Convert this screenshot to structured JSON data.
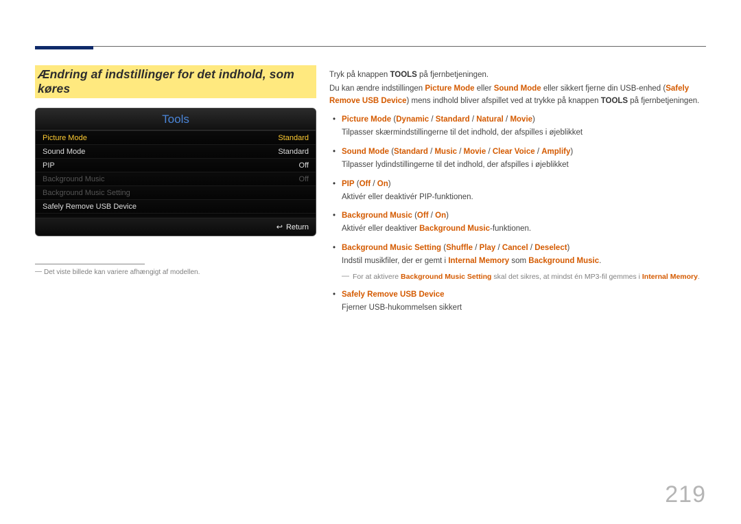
{
  "page_number": "219",
  "heading": "Ændring af indstillinger for det indhold, som køres",
  "tools_panel": {
    "title": "Tools",
    "rows": [
      {
        "label": "Picture Mode",
        "value": "Standard",
        "state": "selected"
      },
      {
        "label": "Sound Mode",
        "value": "Standard",
        "state": "normal"
      },
      {
        "label": "PIP",
        "value": "Off",
        "state": "normal"
      },
      {
        "label": "Background Music",
        "value": "Off",
        "state": "dim"
      },
      {
        "label": "Background Music Setting",
        "value": "",
        "state": "dim"
      },
      {
        "label": "Safely Remove USB Device",
        "value": "",
        "state": "normal"
      }
    ],
    "footer_label": "Return"
  },
  "footnote": "Det viste billede kan variere afhængigt af modellen.",
  "intro": {
    "line1_a": "Tryk på knappen ",
    "line1_b": "TOOLS",
    "line1_c": " på fjernbetjeningen.",
    "line2_a": "Du kan ændre indstillingen ",
    "line2_b": "Picture Mode",
    "line2_c": " eller ",
    "line2_d": "Sound Mode",
    "line2_e": " eller sikkert fjerne din USB-enhed (",
    "line2_f": "Safely Remove USB Device",
    "line2_g": ") mens indhold bliver afspillet ved at trykke på knappen ",
    "line2_h": "TOOLS",
    "line2_i": " på fjernbetjeningen."
  },
  "items": {
    "pm": {
      "t1": "Picture Mode",
      "p": " (",
      "o1": "Dynamic",
      "s": " / ",
      "o2": "Standard",
      "o3": "Natural",
      "o4": "Movie",
      "q": ")",
      "desc": "Tilpasser skærmindstillingerne til det indhold, der afspilles i øjeblikket"
    },
    "sm": {
      "t1": "Sound Mode",
      "p": " (",
      "o1": "Standard",
      "s": " / ",
      "o2": "Music",
      "o3": "Movie",
      "o4": "Clear Voice",
      "o5": "Amplify",
      "q": ")",
      "desc": "Tilpasser lydindstillingerne til det indhold, der afspilles i øjeblikket"
    },
    "pip": {
      "t1": "PIP",
      "p": " (",
      "o1": "Off",
      "s": " / ",
      "o2": "On",
      "q": ")",
      "desc": "Aktivér eller deaktivér PIP-funktionen."
    },
    "bgm": {
      "t1": "Background Music",
      "p": " (",
      "o1": "Off",
      "s": " / ",
      "o2": "On",
      "q": ")",
      "d1": "Aktivér eller deaktiver ",
      "d2": "Background Music",
      "d3": "-funktionen."
    },
    "bgms": {
      "t1": "Background Music Setting",
      "p": " (",
      "o1": "Shuffle",
      "s": " / ",
      "o2": "Play",
      "o3": "Cancel",
      "o4": "Deselect",
      "q": ")",
      "d1": "Indstil musikfiler, der er gemt i ",
      "d2": "Internal Memory",
      "d3": " som ",
      "d4": "Background Music",
      "d5": ".",
      "n1": "For at aktivere ",
      "n2": "Background Music Setting",
      "n3": " skal det sikres, at mindst én MP3-fil gemmes i ",
      "n4": "Internal Memory",
      "n5": "."
    },
    "srud": {
      "t1": "Safely Remove USB Device",
      "desc": "Fjerner USB-hukommelsen sikkert"
    }
  }
}
